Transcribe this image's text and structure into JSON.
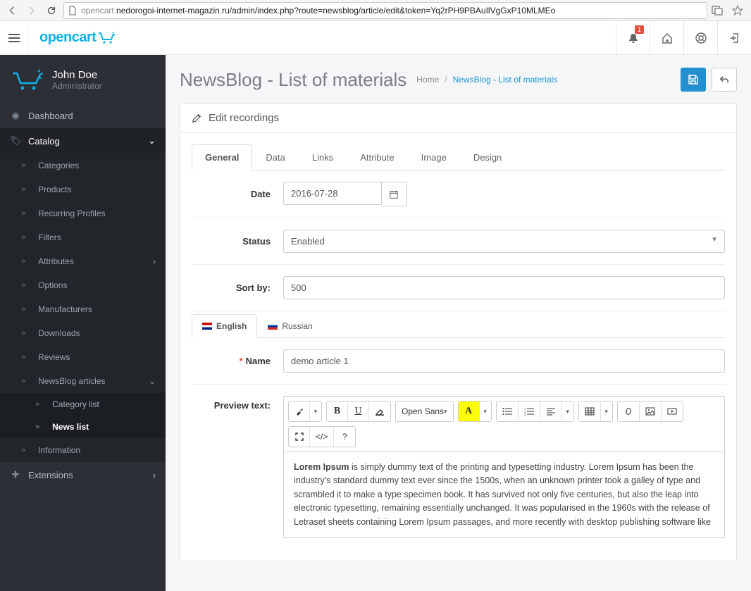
{
  "browser": {
    "url_prefix": "opencart.",
    "url_rest": "nedorogoi-internet-magazin.ru/admin/index.php?route=newsblog/article/edit&token=Yq2rPH9PBAuIlVgGxP10MLMEo"
  },
  "header": {
    "logo": "opencart",
    "notif_count": "1"
  },
  "user": {
    "name": "John Doe",
    "role": "Administrator"
  },
  "menu": {
    "dashboard": "Dashboard",
    "catalog": "Catalog",
    "categories": "Categories",
    "products": "Products",
    "recurring": "Recurring Profiles",
    "filters": "Filters",
    "attributes": "Attributes",
    "options": "Options",
    "manufacturers": "Manufacturers",
    "downloads": "Downloads",
    "reviews": "Reviews",
    "newsblog": "NewsBlog articles",
    "category_list": "Category list",
    "news_list": "News list",
    "information": "Information",
    "extensions": "Extensions"
  },
  "page": {
    "title": "NewsBlog - List of materials",
    "crumb_home": "Home",
    "crumb_current": "NewsBlog - List of materials",
    "panel_title": "Edit recordings"
  },
  "tabs": {
    "general": "General",
    "data": "Data",
    "links": "Links",
    "attribute": "Attribute",
    "image": "Image",
    "design": "Design"
  },
  "form": {
    "date_label": "Date",
    "date_value": "2016-07-28",
    "status_label": "Status",
    "status_value": "Enabled",
    "sort_label": "Sort by:",
    "sort_value": "500",
    "lang_en": "English",
    "lang_ru": "Russian",
    "name_label": "Name",
    "name_value": "demo article 1",
    "preview_label": "Preview text:",
    "font_family": "Open Sans",
    "font_color_label": "A",
    "code_btn": "</>",
    "help_btn": "?"
  },
  "editor": {
    "lead": "Lorem Ipsum",
    "body": " is simply dummy text of the printing and typesetting industry. Lorem Ipsum has been the industry's standard dummy text ever since the 1500s, when an unknown printer took a galley of type and scrambled it to make a type specimen book. It has survived not only five centuries, but also the leap into electronic typesetting, remaining essentially unchanged. It was popularised in the 1960s with the release of Letraset sheets containing Lorem Ipsum passages, and more recently with desktop publishing software like"
  }
}
